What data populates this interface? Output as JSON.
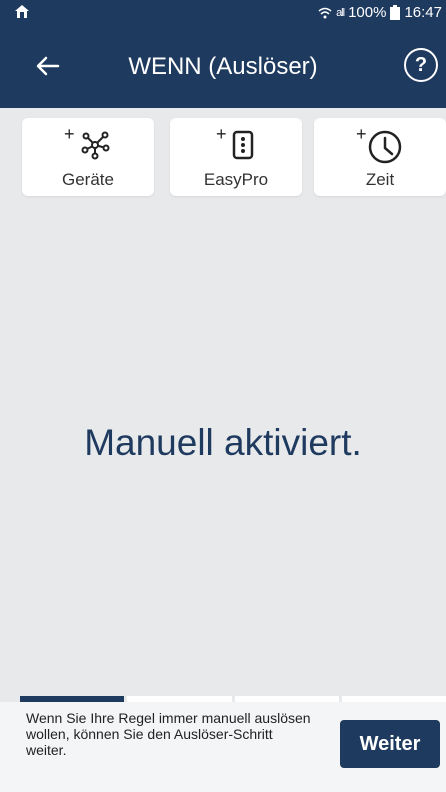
{
  "statusbar": {
    "signal": "all",
    "battery": "100%",
    "time": "16:47"
  },
  "appbar": {
    "title": "WENN (Auslöser)",
    "help": "?"
  },
  "cards": [
    {
      "plus": "+",
      "label": "Geräte",
      "icon": "network-icon"
    },
    {
      "plus": "+",
      "label": "EasyPro",
      "icon": "remote-icon"
    },
    {
      "plus": "+",
      "label": "Zeit",
      "icon": "clock-icon"
    }
  ],
  "main": {
    "text": "Manuell aktiviert."
  },
  "progress": {
    "active_step": 1,
    "total_steps": 4
  },
  "footer": {
    "hint": "Wenn Sie Ihre Regel immer manuell auslösen wollen, können Sie den Auslöser-Schritt weiter.",
    "next_label": "Weiter"
  },
  "colors": {
    "primary": "#1f3a5f",
    "background": "#e8e9eb",
    "card": "#ffffff"
  }
}
